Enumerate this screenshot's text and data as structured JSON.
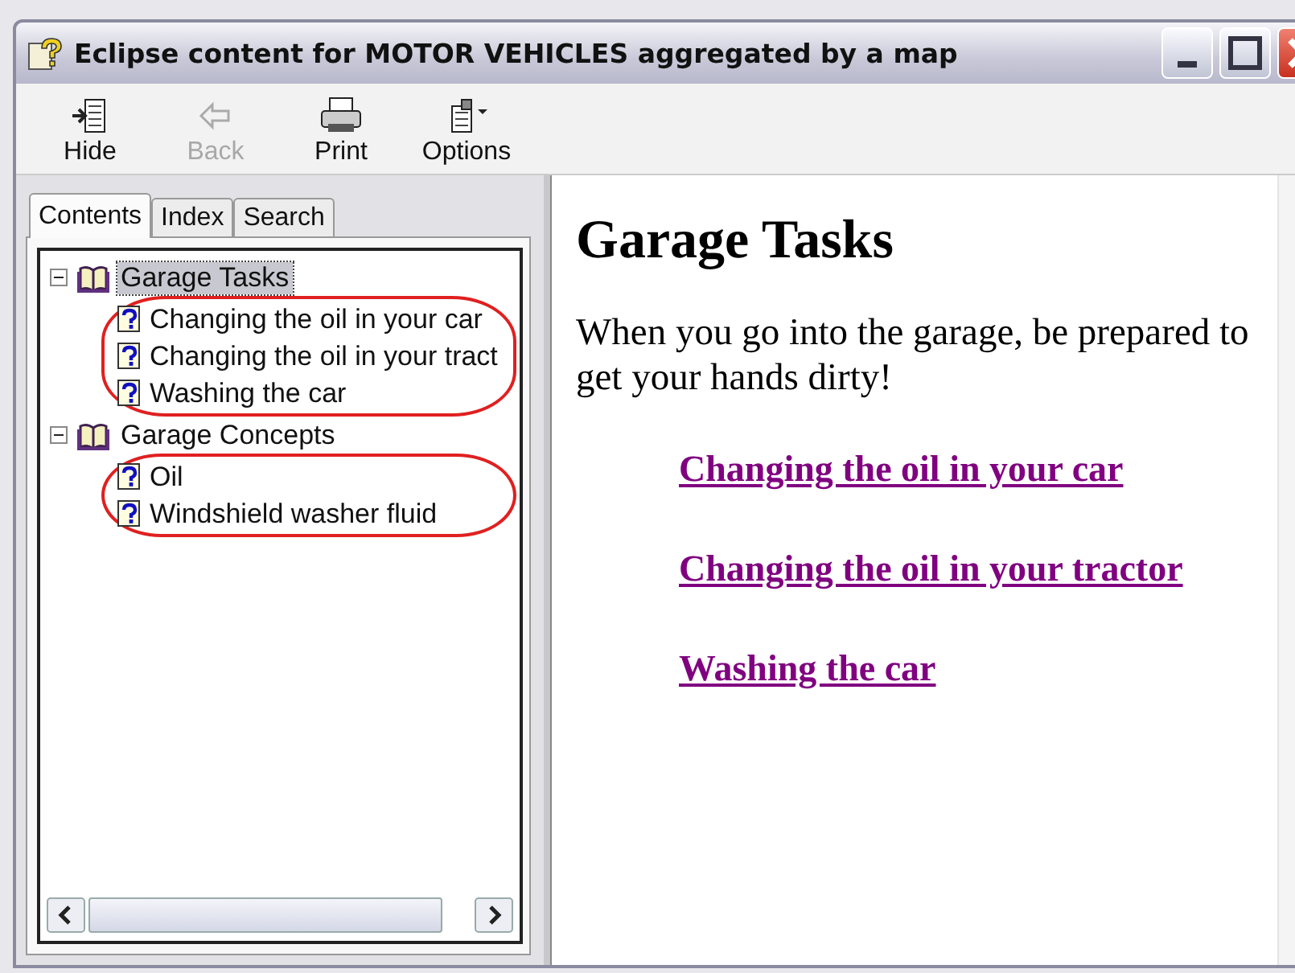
{
  "window": {
    "title": "Eclipse content for MOTOR VEHICLES aggregated by a map"
  },
  "toolbar": [
    {
      "label": "Hide",
      "kind": "hide",
      "disabled": false
    },
    {
      "label": "Back",
      "kind": "back",
      "disabled": true
    },
    {
      "label": "Print",
      "kind": "print",
      "disabled": false
    },
    {
      "label": "Options",
      "kind": "options",
      "disabled": false
    }
  ],
  "tabs": [
    {
      "label": "Contents",
      "selected": true
    },
    {
      "label": "Index",
      "selected": false
    },
    {
      "label": "Search",
      "selected": false
    }
  ],
  "tree": [
    {
      "label": "Garage Tasks",
      "expanded": true,
      "selected": true,
      "circled": true,
      "children": [
        {
          "label": "Changing the oil in your car"
        },
        {
          "label": "Changing the oil in your tract"
        },
        {
          "label": "Washing the car"
        }
      ]
    },
    {
      "label": "Garage Concepts",
      "expanded": true,
      "selected": false,
      "circled": true,
      "children": [
        {
          "label": "Oil"
        },
        {
          "label": "Windshield washer fluid"
        }
      ]
    }
  ],
  "content": {
    "heading": "Garage Tasks",
    "text": "When you go into the garage, be prepared to get your hands dirty!",
    "links": [
      "Changing the oil in your car",
      "Changing the oil in your tractor",
      "Washing the car"
    ]
  }
}
